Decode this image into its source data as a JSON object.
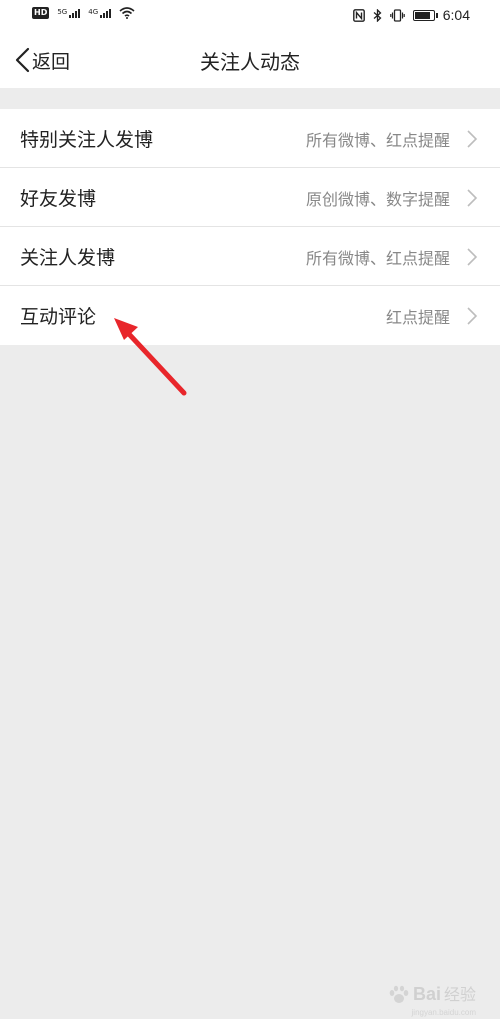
{
  "status_bar": {
    "hd_badge": "HD",
    "sim1_network": "5G",
    "sim2_network": "4G",
    "time": "6:04",
    "icons": [
      "nfc-icon",
      "bluetooth-icon",
      "vibrate-icon",
      "battery-icon"
    ]
  },
  "nav": {
    "back_label": "返回",
    "title": "关注人动态"
  },
  "settings": [
    {
      "label": "特别关注人发博",
      "value": "所有微博、红点提醒"
    },
    {
      "label": "好友发博",
      "value": "原创微博、数字提醒"
    },
    {
      "label": "关注人发博",
      "value": "所有微博、红点提醒"
    },
    {
      "label": "互动评论",
      "value": "红点提醒"
    }
  ],
  "annotation": {
    "color": "#e8262b"
  },
  "watermark": {
    "logo": "Bai",
    "text": "经验",
    "sub": "jingyan.baidu.com"
  },
  "colors": {
    "background": "#ececec",
    "panel": "#ffffff",
    "value_text": "#888888"
  }
}
